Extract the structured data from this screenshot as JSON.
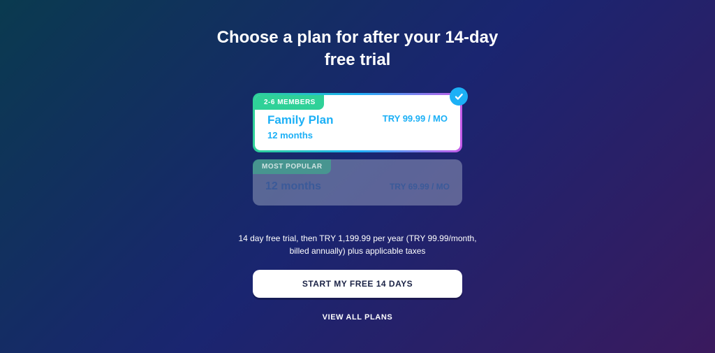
{
  "header": {
    "title": "Choose a plan for after your 14-day\nfree trial"
  },
  "plans": [
    {
      "badge": "2-6 MEMBERS",
      "name": "Family Plan",
      "duration": "12 months",
      "price": "TRY 99.99 / MO"
    },
    {
      "badge": "MOST POPULAR",
      "duration": "12 months",
      "price": "TRY 69.99 / MO"
    }
  ],
  "disclaimer": "14 day free trial, then TRY 1,199.99 per year (TRY 99.99/month, billed annually) plus applicable taxes",
  "cta": {
    "primary": "START MY FREE 14 DAYS",
    "secondary": "VIEW ALL PLANS"
  }
}
